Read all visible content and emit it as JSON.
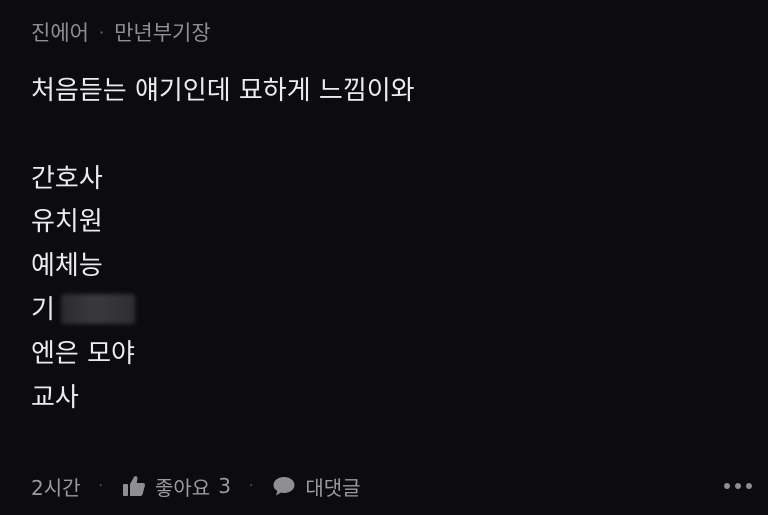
{
  "comment": {
    "author": "진에어",
    "separator": "·",
    "badge": "만년부기장",
    "lines": [
      "처음듣는 얘기인데 묘하게 느낌이와",
      "",
      "간호사",
      "유치원",
      "예체능",
      "기",
      "엔은 모야",
      "교사"
    ],
    "time": "2시간",
    "like_label": "좋아요",
    "like_count": "3",
    "reply_label": "대댓글"
  },
  "icons": {
    "like": "thumbs-up-icon",
    "reply": "speech-bubble-icon",
    "more": "more-dots-icon"
  },
  "colors": {
    "background": "#0c0c0e",
    "text": "#ececee",
    "muted": "#8e8e93"
  }
}
